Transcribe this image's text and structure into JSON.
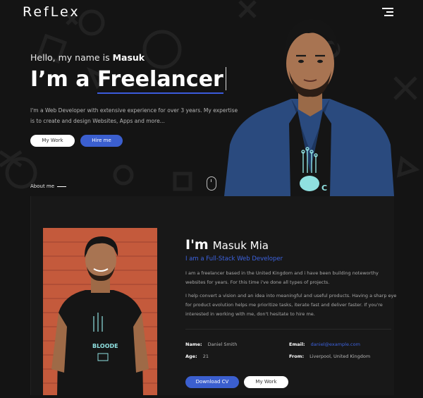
{
  "header": {
    "logo": "RefLex",
    "menu_icon": "hamburger-menu-icon"
  },
  "hero": {
    "greeting": "Hello, my name is",
    "name": "Masuk",
    "headline_prefix": "I’m a",
    "headline_role": "Freelancer",
    "intro": "I'm a Web Developer with extensive experience for over 3 years. My expertise is to create and design Websites, Apps and more...",
    "buttons": {
      "work": "My Work",
      "hire": "Hire me"
    },
    "scroll_icon": "mouse-scroll-icon",
    "accent_color": "#3b5fcf"
  },
  "nav": {
    "about_link": "About me"
  },
  "about": {
    "im": "I'm",
    "full_name": "Masuk Mia",
    "role": "I am a Full-Stack Web Developer",
    "paragraph1": "I am a freelancer based in the United Kingdom and i have been building noteworthy websites for years. For this time i've done all types of projects.",
    "paragraph2": "I help convert a vision and an idea into meaningful and useful products. Having a sharp eye for product evolution helps me prioritize tasks, iterate fast and deliver faster. If you're interested in working with me, don't hesitate to hire me.",
    "details": {
      "name_label": "Name:",
      "name_value": "Daniel Smith",
      "age_label": "Age:",
      "age_value": "21",
      "email_label": "Email:",
      "email_value": "daniel@example.com",
      "from_label": "From:",
      "from_value": "Liverpool, United Kingdom"
    },
    "buttons": {
      "download_cv": "Download CV",
      "work": "My Work"
    }
  }
}
